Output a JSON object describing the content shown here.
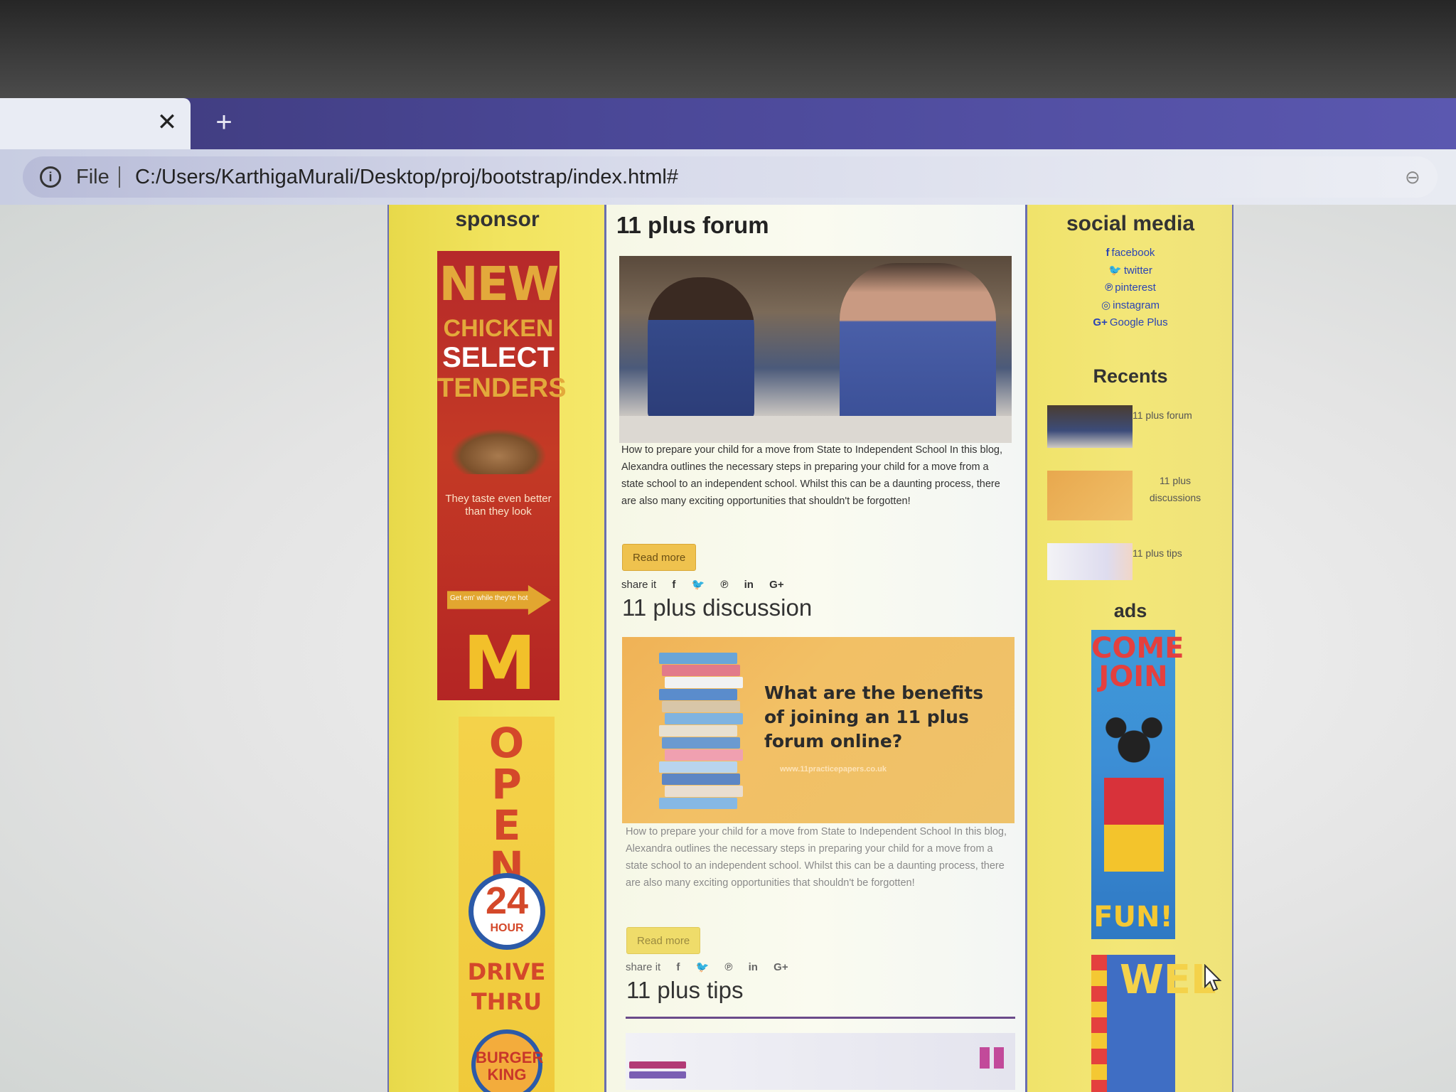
{
  "browser": {
    "tab_close_glyph": "✕",
    "new_tab_glyph": "+",
    "scheme_label": "File",
    "url": "C:/Users/KarthigaMurali/Desktop/proj/bootstrap/index.html#",
    "info_icon": "i"
  },
  "sponsor": {
    "title": "sponsor",
    "mcd_ad": {
      "new": "NEW",
      "chicken": "CHICKEN",
      "select": "SELECT",
      "tenders": "TENDERS",
      "tagline": "They taste even better than they look",
      "arrow_text": "Get em' while they're hot",
      "logo": "M"
    },
    "bk_ad": {
      "open": "OPEN",
      "hours_num": "24",
      "hours_label": "HOUR",
      "drive": "DRIVE",
      "thru": "THRU",
      "logo": "BURGER KING"
    }
  },
  "main": {
    "posts": [
      {
        "title": "11 plus forum",
        "body": "How to prepare your child for a move from State to Independent School In this blog, Alexandra outlines the necessary steps in preparing your child for a move from a state school to an independent school. Whilst this can be a daunting process, there are also many exciting opportunities that shouldn't be forgotten!",
        "read_more": "Read more",
        "share_label": "share it"
      },
      {
        "title": "11 plus discussion",
        "image_headline": "What are the benefits of joining an 11 plus forum online?",
        "image_url_text": "www.11practicepapers.co.uk",
        "body": "How to prepare your child for a move from State to Independent School In this blog, Alexandra outlines the necessary steps in preparing your child for a move from a state school to an independent school. Whilst this can be a daunting process, there are also many exciting opportunities that shouldn't be forgotten!",
        "read_more": "Read more",
        "share_label": "share it"
      },
      {
        "title": "11 plus tips"
      }
    ],
    "share_icons": [
      "f",
      "🐦",
      "℗",
      "in",
      "G+"
    ]
  },
  "social": {
    "title": "social media",
    "links": [
      {
        "icon": "f",
        "label": "facebook"
      },
      {
        "icon": "🐦",
        "label": "twitter"
      },
      {
        "icon": "℗",
        "label": "pinterest"
      },
      {
        "icon": "◎",
        "label": "instagram"
      },
      {
        "icon": "G+",
        "label": "Google Plus"
      }
    ],
    "link_color": "#2a44b5"
  },
  "recents": {
    "title": "Recents",
    "items": [
      {
        "label": "11 plus forum"
      },
      {
        "label": "11 plus discussions"
      },
      {
        "label": "11 plus tips"
      }
    ]
  },
  "ads": {
    "title": "ads",
    "mickey_ad": {
      "top": "COME JOIN",
      "bottom": "FUN!"
    },
    "welcome_ad": {
      "text": "WEL"
    }
  }
}
